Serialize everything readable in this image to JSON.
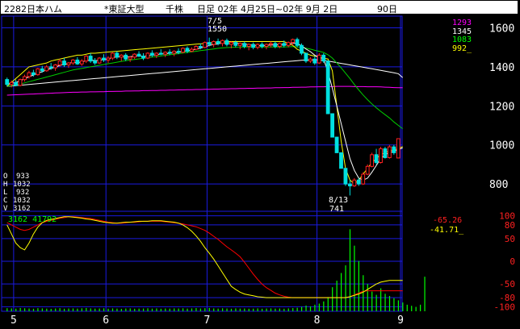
{
  "header": {
    "code_name": "2282日本ハム",
    "market": "*東証大型",
    "unit": "千株",
    "period": "日足 02年 4月25日~02年 9月 2日",
    "days": "90日"
  },
  "colors": {
    "up": "#ff2020",
    "down": "#00e0e0",
    "ma_short": "#ffffff",
    "ma_mid": "#00cc00",
    "ma_long": "#ffffff",
    "ma_xlong": "#ff00ff",
    "osc_red": "#ff0000",
    "osc_yellow": "#ffff00",
    "volume": "#00ff00",
    "grid": "#1a1ae0",
    "axis_text": "#ffffff"
  },
  "legend_price": {
    "values": [
      "1293",
      "1345",
      "1083",
      "992_"
    ],
    "colors": [
      "#ff00ff",
      "#ffffff",
      "#00ff00",
      "#ffff00"
    ]
  },
  "ohlcv": {
    "o_label": "O",
    "o_value": "933",
    "h_label": "H",
    "h_value": "1032",
    "l_label": "L",
    "l_value": "932",
    "c_label": "C",
    "c_value": "1032",
    "v_label": "V",
    "v_value": "3162"
  },
  "osc_legend": {
    "left": "3162 41792",
    "right_top": "-65.26",
    "right_bottom": "-41.71_"
  },
  "annotations": {
    "high_date": "7/5",
    "high_value": "1550",
    "low_date": "8/13",
    "low_value": "741"
  },
  "chart_data": {
    "type": "candlestick",
    "price_axis": {
      "ticks": [
        800,
        1000,
        1200,
        1400,
        1600
      ],
      "ylim": [
        660,
        1660
      ]
    },
    "osc_axis": {
      "ticks": [
        100,
        80,
        50,
        0,
        -50,
        -80,
        -100
      ],
      "ylim": [
        -110,
        110
      ]
    },
    "month_labels": [
      "5",
      "6",
      "7",
      "8",
      "9"
    ],
    "month_start_index": [
      2,
      23,
      46,
      71,
      90
    ],
    "candles": [
      [
        1335,
        1345,
        1300,
        1310
      ],
      [
        1310,
        1330,
        1295,
        1320
      ],
      [
        1320,
        1335,
        1300,
        1305
      ],
      [
        1305,
        1340,
        1300,
        1335
      ],
      [
        1335,
        1360,
        1325,
        1350
      ],
      [
        1350,
        1380,
        1340,
        1370
      ],
      [
        1370,
        1385,
        1350,
        1360
      ],
      [
        1360,
        1395,
        1355,
        1390
      ],
      [
        1390,
        1405,
        1370,
        1380
      ],
      [
        1380,
        1410,
        1375,
        1400
      ],
      [
        1400,
        1420,
        1385,
        1395
      ],
      [
        1395,
        1415,
        1380,
        1410
      ],
      [
        1410,
        1440,
        1400,
        1430
      ],
      [
        1430,
        1445,
        1400,
        1410
      ],
      [
        1410,
        1425,
        1395,
        1420
      ],
      [
        1420,
        1440,
        1410,
        1435
      ],
      [
        1435,
        1450,
        1410,
        1415
      ],
      [
        1415,
        1440,
        1405,
        1430
      ],
      [
        1430,
        1460,
        1420,
        1455
      ],
      [
        1455,
        1470,
        1420,
        1430
      ],
      [
        1430,
        1445,
        1410,
        1420
      ],
      [
        1420,
        1450,
        1415,
        1445
      ],
      [
        1445,
        1465,
        1425,
        1435
      ],
      [
        1435,
        1455,
        1420,
        1445
      ],
      [
        1445,
        1475,
        1435,
        1470
      ],
      [
        1470,
        1480,
        1440,
        1450
      ],
      [
        1450,
        1465,
        1430,
        1460
      ],
      [
        1460,
        1470,
        1430,
        1440
      ],
      [
        1440,
        1455,
        1425,
        1450
      ],
      [
        1450,
        1470,
        1440,
        1465
      ],
      [
        1465,
        1480,
        1450,
        1455
      ],
      [
        1455,
        1470,
        1435,
        1445
      ],
      [
        1445,
        1475,
        1440,
        1470
      ],
      [
        1470,
        1485,
        1450,
        1460
      ],
      [
        1460,
        1475,
        1445,
        1470
      ],
      [
        1470,
        1490,
        1460,
        1465
      ],
      [
        1465,
        1480,
        1450,
        1475
      ],
      [
        1475,
        1490,
        1460,
        1470
      ],
      [
        1470,
        1485,
        1455,
        1480
      ],
      [
        1480,
        1495,
        1465,
        1475
      ],
      [
        1475,
        1500,
        1470,
        1495
      ],
      [
        1495,
        1505,
        1470,
        1480
      ],
      [
        1480,
        1500,
        1475,
        1490
      ],
      [
        1490,
        1510,
        1485,
        1505
      ],
      [
        1505,
        1520,
        1490,
        1500
      ],
      [
        1500,
        1530,
        1495,
        1525
      ],
      [
        1525,
        1550,
        1505,
        1515
      ],
      [
        1515,
        1535,
        1500,
        1530
      ],
      [
        1530,
        1545,
        1510,
        1520
      ],
      [
        1520,
        1540,
        1505,
        1535
      ],
      [
        1535,
        1545,
        1505,
        1515
      ],
      [
        1515,
        1530,
        1495,
        1525
      ],
      [
        1525,
        1535,
        1500,
        1510
      ],
      [
        1510,
        1525,
        1490,
        1520
      ],
      [
        1520,
        1530,
        1495,
        1505
      ],
      [
        1505,
        1520,
        1485,
        1515
      ],
      [
        1515,
        1525,
        1490,
        1500
      ],
      [
        1500,
        1520,
        1490,
        1515
      ],
      [
        1515,
        1525,
        1495,
        1505
      ],
      [
        1505,
        1520,
        1490,
        1515
      ],
      [
        1515,
        1530,
        1500,
        1520
      ],
      [
        1520,
        1530,
        1495,
        1505
      ],
      [
        1505,
        1525,
        1495,
        1520
      ],
      [
        1520,
        1535,
        1500,
        1510
      ],
      [
        1510,
        1530,
        1500,
        1525
      ],
      [
        1525,
        1545,
        1510,
        1540
      ],
      [
        1540,
        1550,
        1500,
        1510
      ],
      [
        1510,
        1520,
        1460,
        1470
      ],
      [
        1470,
        1470,
        1420,
        1430
      ],
      [
        1430,
        1450,
        1420,
        1440
      ],
      [
        1440,
        1455,
        1410,
        1420
      ],
      [
        1420,
        1470,
        1415,
        1460
      ],
      [
        1460,
        1470,
        1420,
        1430
      ],
      [
        1430,
        1430,
        1160,
        1160
      ],
      [
        1160,
        1160,
        1040,
        1040
      ],
      [
        1040,
        1040,
        960,
        960
      ],
      [
        960,
        960,
        880,
        880
      ],
      [
        880,
        880,
        790,
        800
      ],
      [
        800,
        820,
        741,
        790
      ],
      [
        790,
        830,
        785,
        820
      ],
      [
        820,
        830,
        790,
        800
      ],
      [
        800,
        860,
        795,
        850
      ],
      [
        850,
        900,
        845,
        890
      ],
      [
        890,
        960,
        885,
        950
      ],
      [
        950,
        980,
        900,
        910
      ],
      [
        910,
        990,
        905,
        980
      ],
      [
        980,
        990,
        930,
        935
      ],
      [
        935,
        1000,
        930,
        990
      ],
      [
        990,
        1000,
        950,
        960
      ],
      [
        933,
        1032,
        932,
        1032
      ]
    ],
    "volume": [
      280,
      260,
      240,
      300,
      270,
      250,
      230,
      280,
      260,
      240,
      220,
      250,
      280,
      230,
      250,
      260,
      240,
      270,
      300,
      260,
      240,
      250,
      270,
      230,
      260,
      240,
      220,
      250,
      260,
      230,
      240,
      250,
      270,
      240,
      260,
      230,
      250,
      240,
      260,
      250,
      270,
      240,
      260,
      290,
      250,
      280,
      300,
      260,
      240,
      270,
      250,
      230,
      260,
      240,
      250,
      230,
      240,
      260,
      230,
      250,
      260,
      240,
      250,
      230,
      260,
      290,
      320,
      400,
      520,
      450,
      600,
      700,
      900,
      1300,
      2200,
      2800,
      3500,
      4200,
      7500,
      6000,
      4600,
      3300,
      2500,
      1800,
      1500,
      2100,
      1600,
      1400,
      1200,
      1000,
      800,
      600,
      500,
      400,
      600,
      3162
    ],
    "volume_max": 9000,
    "ma_short": [
      1310,
      1318,
      1320,
      1330,
      1338,
      1350,
      1358,
      1368,
      1375,
      1385,
      1392,
      1398,
      1408,
      1412,
      1418,
      1424,
      1422,
      1425,
      1432,
      1436,
      1432,
      1434,
      1437,
      1440,
      1448,
      1450,
      1452,
      1450,
      1452,
      1455,
      1456,
      1454,
      1456,
      1460,
      1461,
      1466,
      1466,
      1470,
      1472,
      1474,
      1480,
      1482,
      1486,
      1490,
      1496,
      1502,
      1510,
      1514,
      1518,
      1522,
      1522,
      1524,
      1522,
      1520,
      1516,
      1514,
      1510,
      1510,
      1508,
      1510,
      1512,
      1512,
      1514,
      1514,
      1516,
      1522,
      1520,
      1508,
      1492,
      1478,
      1460,
      1448,
      1440,
      1375,
      1290,
      1200,
      1110,
      1020,
      930,
      870,
      830,
      820,
      830,
      860,
      895,
      930,
      950,
      960,
      968,
      975,
      985
    ],
    "ma_mid": [
      1300,
      1304,
      1308,
      1312,
      1318,
      1324,
      1330,
      1336,
      1342,
      1348,
      1354,
      1360,
      1366,
      1372,
      1378,
      1384,
      1388,
      1392,
      1396,
      1400,
      1404,
      1408,
      1412,
      1416,
      1420,
      1424,
      1428,
      1432,
      1435,
      1438,
      1441,
      1444,
      1447,
      1450,
      1453,
      1456,
      1459,
      1462,
      1465,
      1468,
      1471,
      1474,
      1477,
      1480,
      1483,
      1486,
      1489,
      1492,
      1495,
      1497,
      1499,
      1500,
      1501,
      1502,
      1502,
      1502,
      1502,
      1502,
      1502,
      1502,
      1502,
      1502,
      1502,
      1502,
      1503,
      1504,
      1503,
      1500,
      1496,
      1491,
      1485,
      1480,
      1474,
      1462,
      1445,
      1420,
      1395,
      1368,
      1340,
      1310,
      1282,
      1256,
      1232,
      1210,
      1190,
      1172,
      1155,
      1138,
      1118,
      1100,
      1083
    ],
    "ma_long": [
      1300,
      1302,
      1304,
      1306,
      1308,
      1310,
      1312,
      1314,
      1316,
      1318,
      1320,
      1322,
      1324,
      1326,
      1328,
      1330,
      1332,
      1334,
      1336,
      1338,
      1340,
      1342,
      1344,
      1346,
      1348,
      1350,
      1352,
      1354,
      1356,
      1358,
      1360,
      1362,
      1364,
      1366,
      1368,
      1370,
      1372,
      1374,
      1376,
      1378,
      1380,
      1382,
      1384,
      1386,
      1388,
      1390,
      1392,
      1394,
      1396,
      1398,
      1400,
      1402,
      1404,
      1406,
      1408,
      1410,
      1412,
      1414,
      1416,
      1418,
      1420,
      1422,
      1424,
      1426,
      1428,
      1430,
      1432,
      1434,
      1435,
      1436,
      1436,
      1436,
      1434,
      1430,
      1426,
      1422,
      1418,
      1414,
      1410,
      1406,
      1402,
      1398,
      1394,
      1390,
      1386,
      1382,
      1378,
      1374,
      1370,
      1365,
      1345
    ],
    "ma_xlong": [
      1255,
      1256,
      1257,
      1258,
      1259,
      1260,
      1261,
      1262,
      1263,
      1264,
      1265,
      1266,
      1267,
      1268,
      1269,
      1270,
      1270,
      1271,
      1271,
      1272,
      1272,
      1273,
      1273,
      1274,
      1274,
      1275,
      1275,
      1276,
      1276,
      1277,
      1277,
      1278,
      1278,
      1279,
      1279,
      1280,
      1280,
      1281,
      1281,
      1282,
      1282,
      1283,
      1283,
      1284,
      1284,
      1285,
      1285,
      1286,
      1286,
      1287,
      1287,
      1288,
      1288,
      1289,
      1289,
      1290,
      1290,
      1291,
      1291,
      1292,
      1292,
      1293,
      1293,
      1294,
      1294,
      1295,
      1295,
      1296,
      1296,
      1297,
      1297,
      1298,
      1298,
      1299,
      1299,
      1300,
      1300,
      1300,
      1300,
      1299,
      1299,
      1299,
      1298,
      1298,
      1298,
      1297,
      1296,
      1295,
      1294,
      1293,
      1293
    ],
    "ma_yellow": [
      1300,
      1320,
      1340,
      1360,
      1380,
      1400,
      1405,
      1410,
      1415,
      1420,
      1430,
      1435,
      1440,
      1445,
      1450,
      1455,
      1460,
      1460,
      1465,
      1470,
      1470,
      1472,
      1474,
      1476,
      1478,
      1480,
      1482,
      1484,
      1486,
      1488,
      1490,
      1492,
      1494,
      1496,
      1498,
      1500,
      1502,
      1504,
      1506,
      1508,
      1510,
      1512,
      1514,
      1516,
      1518,
      1520,
      1522,
      1524,
      1526,
      1528,
      1530,
      1530,
      1530,
      1530,
      1530,
      1530,
      1530,
      1530,
      1530,
      1530,
      1530,
      1530,
      1530,
      1530,
      1520,
      1510,
      1490,
      1480,
      1470,
      1460,
      1455,
      1450,
      1445,
      1440,
      1380,
      1200,
      1020,
      880,
      820,
      800,
      820,
      850,
      880,
      910,
      930,
      950,
      960,
      970,
      975,
      980,
      992
    ],
    "osc_red": [
      85,
      80,
      75,
      70,
      68,
      70,
      75,
      80,
      85,
      88,
      90,
      92,
      95,
      96,
      98,
      98,
      97,
      96,
      95,
      94,
      92,
      90,
      88,
      86,
      85,
      84,
      84,
      85,
      86,
      86,
      87,
      88,
      88,
      88,
      88,
      88,
      87,
      86,
      85,
      84,
      82,
      80,
      78,
      76,
      72,
      68,
      62,
      55,
      48,
      40,
      32,
      25,
      18,
      10,
      -2,
      -15,
      -28,
      -40,
      -50,
      -58,
      -64,
      -70,
      -74,
      -77,
      -79,
      -80,
      -80,
      -80,
      -80,
      -80,
      -80,
      -80,
      -80,
      -80,
      -80,
      -80,
      -80,
      -80,
      -78,
      -74,
      -70,
      -66,
      -65,
      -65,
      -65,
      -65,
      -65,
      -65,
      -65,
      -65,
      -65
    ],
    "osc_yellow": [
      80,
      60,
      40,
      30,
      25,
      40,
      60,
      75,
      85,
      90,
      92,
      94,
      96,
      98,
      98,
      97,
      96,
      95,
      93,
      92,
      90,
      88,
      86,
      85,
      84,
      84,
      85,
      86,
      86,
      87,
      88,
      88,
      88,
      89,
      89,
      89,
      88,
      87,
      86,
      84,
      80,
      74,
      66,
      56,
      44,
      30,
      18,
      5,
      -10,
      -25,
      -40,
      -55,
      -62,
      -68,
      -72,
      -74,
      -76,
      -78,
      -79,
      -80,
      -80,
      -80,
      -80,
      -80,
      -80,
      -80,
      -80,
      -80,
      -80,
      -80,
      -80,
      -80,
      -80,
      -80,
      -80,
      -80,
      -80,
      -80,
      -78,
      -75,
      -72,
      -68,
      -62,
      -56,
      -50,
      -46,
      -44,
      -42,
      -42,
      -42,
      -42
    ]
  }
}
